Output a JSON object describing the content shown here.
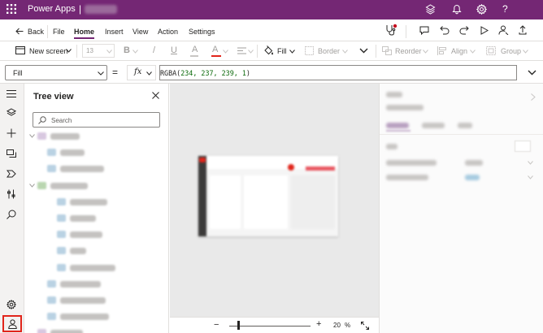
{
  "app": {
    "name": "Power Apps",
    "separator": "|"
  },
  "menu": {
    "back": "Back",
    "items": [
      "File",
      "Home",
      "Insert",
      "View",
      "Action",
      "Settings"
    ],
    "active": "Home"
  },
  "toolbar": {
    "new_screen": "New screen",
    "font_size": "13",
    "bold": "B",
    "italic": "/",
    "underline": "U",
    "font_color": "A",
    "fill": "Fill",
    "border": "Border",
    "reorder": "Reorder",
    "align": "Align",
    "group": "Group"
  },
  "formula_bar": {
    "property": "Fill",
    "equals": "=",
    "fx": "fx",
    "formula_fn": "RGBA(",
    "formula_args": "234, 237, 239, 1",
    "formula_end": ")"
  },
  "tree": {
    "title": "Tree view",
    "search_placeholder": "Search",
    "items": [
      {
        "indent": 0,
        "kind": "screen"
      },
      {
        "indent": 1,
        "kind": "control"
      },
      {
        "indent": 1,
        "kind": "control"
      },
      {
        "indent": 0,
        "kind": "gallery"
      },
      {
        "indent": 2,
        "kind": "control"
      },
      {
        "indent": 2,
        "kind": "control"
      },
      {
        "indent": 2,
        "kind": "control"
      },
      {
        "indent": 2,
        "kind": "control"
      },
      {
        "indent": 2,
        "kind": "control"
      },
      {
        "indent": 1,
        "kind": "control"
      },
      {
        "indent": 1,
        "kind": "control"
      },
      {
        "indent": 1,
        "kind": "control"
      },
      {
        "indent": 0,
        "kind": "screen"
      }
    ]
  },
  "zoom": {
    "minus": "−",
    "plus": "+",
    "value": "20",
    "unit": "%",
    "level": 0.2
  },
  "colors": {
    "brand": "#742774",
    "accent_red": "#e1251b",
    "canvas": "#e9e9e9"
  }
}
